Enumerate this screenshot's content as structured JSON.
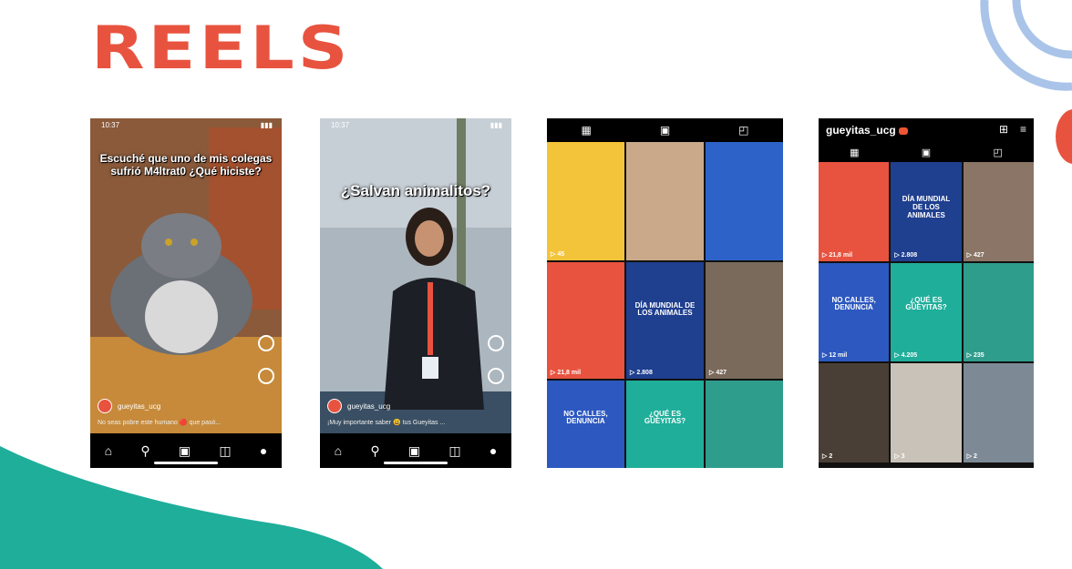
{
  "page": {
    "title": "REELS",
    "colors": {
      "accent": "#e8533f",
      "wave": "#1fae9a",
      "arcs": "#a9c4e8"
    }
  },
  "phone1": {
    "time": "10:37",
    "caption": "Escuché que uno de mis colegas sufrió M4ltrat0 ¿Qué hiciste?",
    "username": "gueyitas_ucg",
    "description": "No seas pobre este humano 🔴 que pasó...",
    "nav_icons": [
      "home-icon",
      "search-icon",
      "reels-icon",
      "shop-icon",
      "profile-icon"
    ]
  },
  "phone2": {
    "time": "10:37",
    "caption": "¿Salvan animalitos?",
    "username": "gueyitas_ucg",
    "description": "¡Muy importante saber 😃 tus Gueyitas ...",
    "nav_icons": [
      "home-icon",
      "search-icon",
      "reels-icon",
      "shop-icon",
      "profile-icon"
    ]
  },
  "phone3": {
    "tabs": [
      "grid-icon",
      "reels-icon",
      "tagged-icon"
    ],
    "cells": [
      {
        "caption": "",
        "views": "▷ 45",
        "color": "#f3c43a"
      },
      {
        "caption": "",
        "views": "",
        "color": "#c9a98a"
      },
      {
        "caption": "",
        "views": "",
        "color": "#2d63c9"
      },
      {
        "caption": "",
        "views": "▷ 21,8 mil",
        "color": "#e8533f"
      },
      {
        "caption": "DÍA MUNDIAL DE LOS ANIMALES",
        "views": "▷ 2.808",
        "color": "#1f3f8f"
      },
      {
        "caption": "",
        "views": "▷ 427",
        "color": "#7a6a5c"
      },
      {
        "caption": "NO CALLES, DENUNCIA",
        "views": "",
        "color": "#2c58c0"
      },
      {
        "caption": "¿QUÉ ES GÜEYITAS?",
        "views": "",
        "color": "#1fae9a"
      },
      {
        "caption": "",
        "views": "",
        "color": "#2f9d8c"
      }
    ]
  },
  "phone4": {
    "username": "gueyitas_ucg",
    "tabs": [
      "grid-icon",
      "reels-icon",
      "tagged-icon"
    ],
    "cells": [
      {
        "caption": "",
        "views": "▷ 21,8 mil",
        "color": "#e8533f"
      },
      {
        "caption": "DÍA MUNDIAL DE LOS ANIMALES",
        "views": "▷ 2.808",
        "color": "#1f3f8f"
      },
      {
        "caption": "",
        "views": "▷ 427",
        "color": "#8a7566"
      },
      {
        "caption": "NO CALLES, DENUNCIA",
        "views": "▷ 12 mil",
        "color": "#2c58c0"
      },
      {
        "caption": "¿QUÉ ES GÜEYITAS?",
        "views": "▷ 4.205",
        "color": "#1fae9a"
      },
      {
        "caption": "",
        "views": "▷ 235",
        "color": "#2f9d8c"
      },
      {
        "caption": "",
        "views": "▷ 2",
        "color": "#4a3f36"
      },
      {
        "caption": "",
        "views": "▷ 3",
        "color": "#c8c2b8"
      },
      {
        "caption": "",
        "views": "▷ 2",
        "color": "#7d8a96"
      }
    ]
  }
}
